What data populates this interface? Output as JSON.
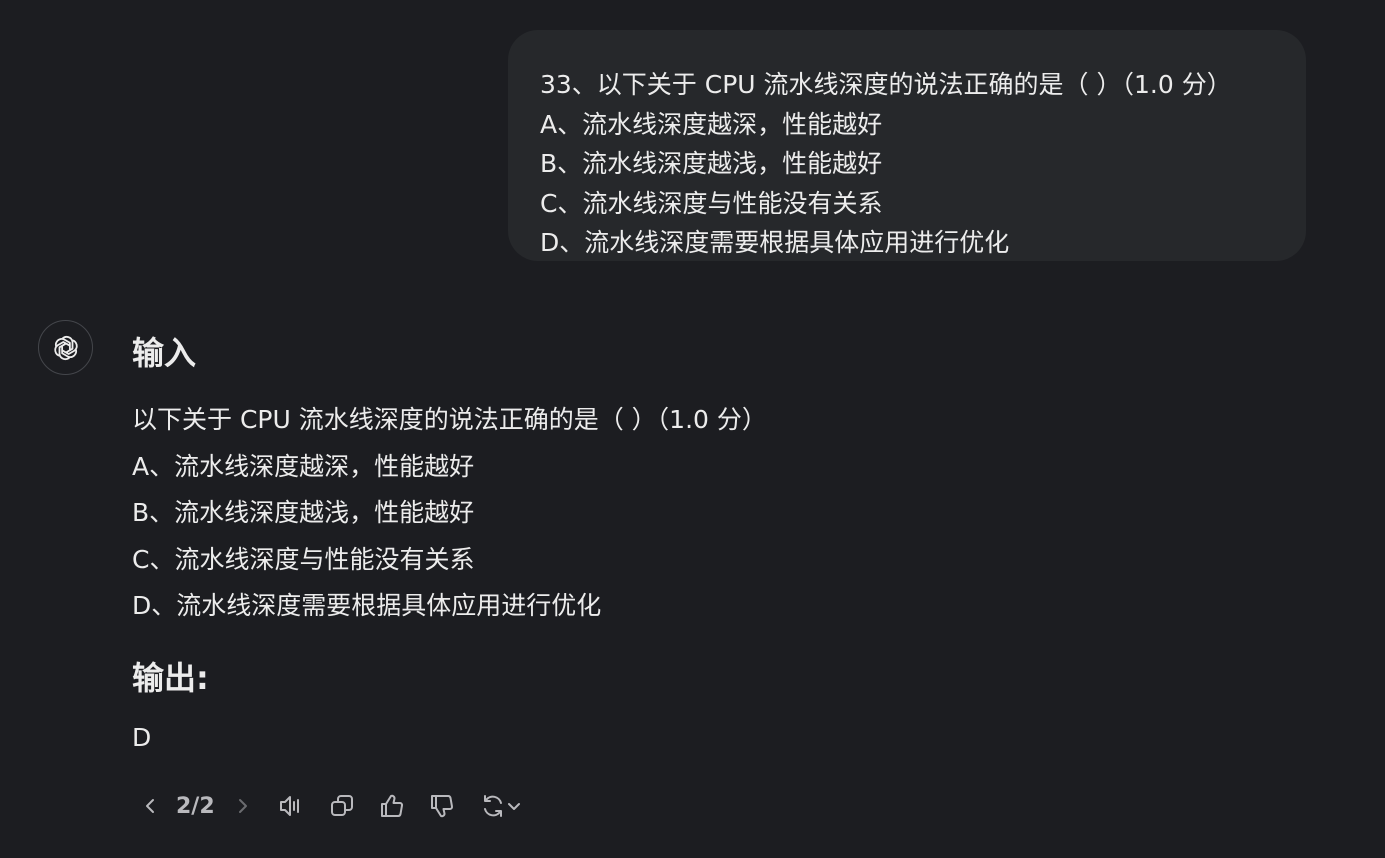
{
  "user_message": {
    "lines": [
      "33、以下关于 CPU 流水线深度的说法正确的是（ ）（1.0 分）",
      "A、流水线深度越深，性能越好",
      "B、流水线深度越浅，性能越好",
      "C、流水线深度与性能没有关系",
      "D、流水线深度需要根据具体应用进行优化"
    ]
  },
  "assistant": {
    "avatar_icon": "openai-logo-icon",
    "input_heading": "输入",
    "input_lines": [
      "以下关于 CPU 流水线深度的说法正确的是（ ）（1.0 分）",
      "A、流水线深度越深，性能越好",
      "B、流水线深度越浅，性能越好",
      "C、流水线深度与性能没有关系",
      "D、流水线深度需要根据具体应用进行优化"
    ],
    "output_heading": "输出:",
    "answer": "D"
  },
  "action_bar": {
    "page_indicator": "2/2",
    "icons": [
      "chevron-left-icon",
      "chevron-right-icon",
      "speaker-icon",
      "copy-icon",
      "thumbs-up-icon",
      "thumbs-down-icon",
      "regenerate-icon",
      "chevron-down-icon"
    ]
  },
  "colors": {
    "background": "#1c1d21",
    "bubble": "#26282b",
    "text": "#ececec",
    "icon": "#b9b9bd",
    "icon_disabled": "#6b6c70"
  }
}
